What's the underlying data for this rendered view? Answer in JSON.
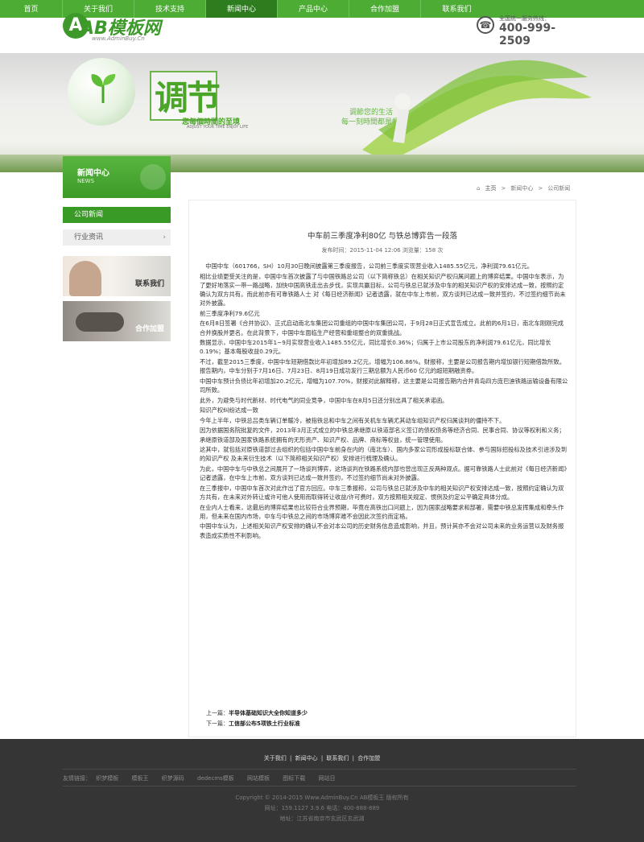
{
  "nav": {
    "items": [
      "首页",
      "关于我们",
      "技术支持",
      "新闻中心",
      "产品中心",
      "合作加盟",
      "联系我们"
    ],
    "active_index": 3
  },
  "logo": {
    "name": "AB模板网",
    "sub": "www.AdminBuy.Cn"
  },
  "phone": {
    "label": "全国统一服务热线：",
    "number": "400-999-2509"
  },
  "banner": {
    "title": "调节",
    "tagline": "您每個時間的至境",
    "tagline_small": "ADJUST YOUR TIME ENJOY LIFE",
    "slogan_1": "调節您的生活",
    "slogan_2": "每一刻時間都是愜意的！"
  },
  "sidebar": {
    "title": "新闻中心",
    "subtitle": "NEWS",
    "menu": [
      {
        "label": "公司新闻",
        "active": true
      },
      {
        "label": "行业资讯",
        "active": false
      }
    ],
    "promos": [
      "联系我们",
      "合作加盟"
    ]
  },
  "breadcrumb": {
    "home": "主页",
    "sep": ">",
    "level1": "新闻中心",
    "level2": "公司新闻"
  },
  "article": {
    "title": "中车前三季度净利80亿 与铁总博弈告一段落",
    "meta": "发布时间：2015-11-04 12:06 浏览量：158 次",
    "paragraphs": [
      "中国中车（601766，SH）10月30日晚间披露第三季度报告，公司前三季度实现营业收入1485.55亿元，净利润79.61亿元。",
      "相比业绩更受关注的是，中国中车首次披露了与中国铁路总公司（以下简称铁总）在相关知识产权归属问题上的博弈结果。中国中车表示，为了更好地落实一带一路战略，加快中国高铁走出去步伐，实现共赢目标，公司与铁总已就涉及中车的相关知识产权的安排达成一致，按照约定确认为双方共有。而此前亦有可靠铁路人士 对《每日经济新闻》记者透露，就在中车上市前，双方谈判已达成一致并签约，不过签约细节尚未对外披露。",
      "前三季度净利79.6亿元",
      "在6月8日签署《合并协议》、正式启动南北车集团公司重组的中国中车集团公司，于9月28日正式宣告成立。此前的6月1日，南北车刚刚完成合并换股并更名。在此背景下，中国中车面临生产经营和重组整合的双重挑战。",
      "数据显示，中国中车2015年1~9月实现营业收入1485.55亿元，同比增长0.36%；归属于上市公司股东的净利润79.61亿元，同比增长0.19%；基本每股收益0.29元。",
      "不过，截至2015三季度，中国中车短期借款比年初增加89.2亿元，增幅为106.86%。财报称，主要是公司报告期内增加银行短期借款所致。报告期内，中车分别于7月16日、7月23日、8月19日成功发行三期总额为人民币60 亿元的超短期融资券。",
      "中国中车预计负债比年初增加20.2亿元，增幅为107.70%，财报对此解释称，这主要是公司报告期内合并青岛四方庞巴迪铁路运输设备有限公司所致。",
      "此外，为避免与时代新材、时代电气的同业竞争，中国中车在8月5日还分别出具了相关承诺函。",
      "知识产权纠纷达成一致",
      "今年上半年，中铁总吕类车辆订单暖冷，被指铁总和中车之间有关机车车辆尤其动车组知识产权归属谈判的僵持不下。",
      "因为依据国务院批复的文件，2013年3月正式成立的中铁总承继原以铁道部名义签订的债权债务等经济合同、民事合同、协议等权利和义务；承继原铁道部及国家铁路系统拥有的无形资产、知识产权、品牌、商标等权益，统一管理使用。",
      "这其中，就包括对原铁道部过去组织的包括中国中车前身在内的（南北车）、国内多家公司形成投标联合体、参与国际招投标及技术引进涉及到的知识产权 及未来衍生技术（以下简称相关知识产权）安排进行梳理及确认。",
      "为此，中国中车与中铁总之间展开了一场谈判博弈，这场谈判在铁路系统内部也曾出现正反两种观点。据可靠铁路人士此前对《每日经济新闻》记者透露，在中车上市前，双方谈判已达成一致并签约，不过签约细节尚未对外披露。",
      "在三季报中，中国中车首次对此作出了官方回应。中车三季报称，公司与铁总已就涉及中车的相关知识产权安排达成一致，按照约定确认为双方共有，在未来对外转让或许可他人使用而取得转让收益/许可费时，双方按照相关规定、惯例及约定公平确定具体分成。",
      "在业内人士看来，这最后的博弈结果也比较符合业界预期，毕竟在高铁出口问题上，因为国家战略要求和部署，需要中铁总发挥集成和牵头作用，但未来在国内市场，中车与中铁总之间的市场博弈难不会因此次签约而定格。",
      "中国中车认为，上述相关知识产权安排的确认不会对本公司的历史财务信息造成影响，并且，预计其亦不会对公司未来的业务运营以及财务报表造成实质性不利影响。"
    ],
    "prev_label": "上一篇：",
    "prev_title": "半导体基础知识大全你知道多少",
    "next_label": "下一篇：",
    "next_title": "工信部公布5项铁土行业标准"
  },
  "footer": {
    "links": [
      "关于我们",
      "新闻中心",
      "联系我们",
      "合作加盟"
    ],
    "link_sep": "|",
    "friend_label": "友情链接：",
    "friends": [
      "织梦模板",
      "模板王",
      "织梦源码",
      "dedecms模板",
      "网站模板",
      "图标下载",
      "网站日"
    ],
    "copyright": "Copyright © 2014-2015 Www.AdminBuy.Cn AB模板王 版权所有",
    "contact": "网址：159.1127 3.9.6    电话：400-888-889",
    "address": "地址：江苏省南京市玄武区玄武湖"
  },
  "colors": {
    "brand_green": "#4cac34",
    "active_green": "#2d7d1e",
    "footer_bg": "#353535"
  }
}
